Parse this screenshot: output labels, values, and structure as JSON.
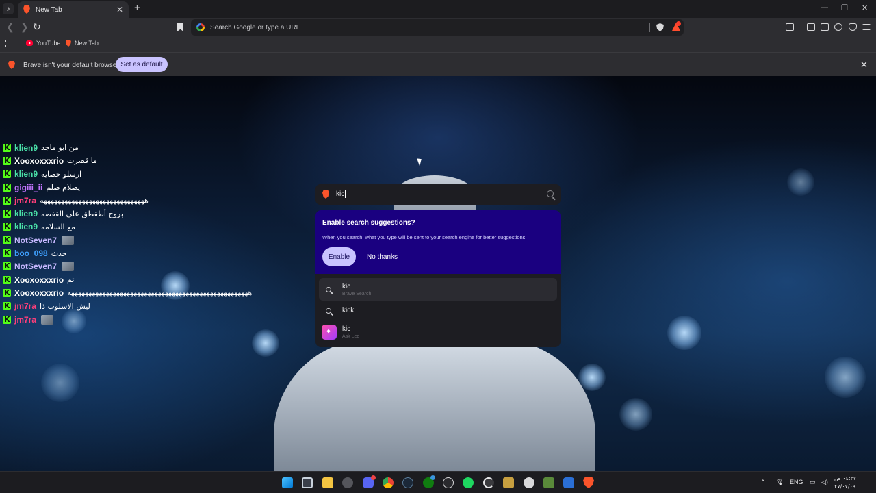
{
  "browser": {
    "tab_title": "New Tab",
    "omnibox_placeholder": "Search Google or type a URL",
    "bookmarks": [
      "YouTube",
      "New Tab"
    ],
    "infobar": {
      "message": "Brave isn't your default browser",
      "button": "Set as default"
    },
    "accent": "#fb542b"
  },
  "chat": [
    {
      "user": "klien9",
      "color": "#4ae0a8",
      "message": "من ابو ماجد",
      "emote": false
    },
    {
      "user": "Xooxoxxxrio",
      "color": "#ffffff",
      "message": "ما قصرت",
      "emote": false
    },
    {
      "user": "klien9",
      "color": "#4ae0a8",
      "message": "ارسلو حصايه",
      "emote": false
    },
    {
      "user": "gigiii_ii",
      "color": "#c274ff",
      "message": "يصلام صلم",
      "emote": false
    },
    {
      "user": "jm7ra",
      "color": "#ff3f7a",
      "message": "ههههههههههههههههههههههههههههههه",
      "emote": false
    },
    {
      "user": "klien9",
      "color": "#4ae0a8",
      "message": "بروح أطقطق على القفصه",
      "emote": false
    },
    {
      "user": "klien9",
      "color": "#4ae0a8",
      "message": "مع السلامه",
      "emote": false
    },
    {
      "user": "NotSeven7",
      "color": "#c7b8ff",
      "message": "",
      "emote": true
    },
    {
      "user": "boo_098",
      "color": "#3fa0ff",
      "message": "حدث",
      "emote": false
    },
    {
      "user": "NotSeven7",
      "color": "#c7b8ff",
      "message": "",
      "emote": true
    },
    {
      "user": "Xooxoxxxrio",
      "color": "#ffffff",
      "message": "تم",
      "emote": false
    },
    {
      "user": "Xooxoxxxrio",
      "color": "#ffffff",
      "message": "ههههههههههههههههههههههههههههههههههههههههههههههههههههه",
      "emote": false
    },
    {
      "user": "jm7ra",
      "color": "#ff3f7a",
      "message": "ليش الاسلوب ذا",
      "emote": false
    },
    {
      "user": "jm7ra",
      "color": "#ff3f7a",
      "message": "",
      "emote": true
    }
  ],
  "search": {
    "query": "kic",
    "promo": {
      "title": "Enable search suggestions?",
      "body": "When you search, what you type will be sent to your search engine for better suggestions.",
      "enable": "Enable",
      "dismiss": "No thanks"
    },
    "results": [
      {
        "text": "kic",
        "sub": "Brave Search",
        "icon": "search-icon"
      },
      {
        "text": "kick",
        "sub": "",
        "icon": "search-icon"
      },
      {
        "text": "kic",
        "sub": "Ask Leo",
        "icon": "leo-icon"
      }
    ]
  },
  "taskbar": {
    "language": "ENG",
    "time": "٠٤:٣٧ ص",
    "date": "٢٧/٠٧/٠٩"
  }
}
